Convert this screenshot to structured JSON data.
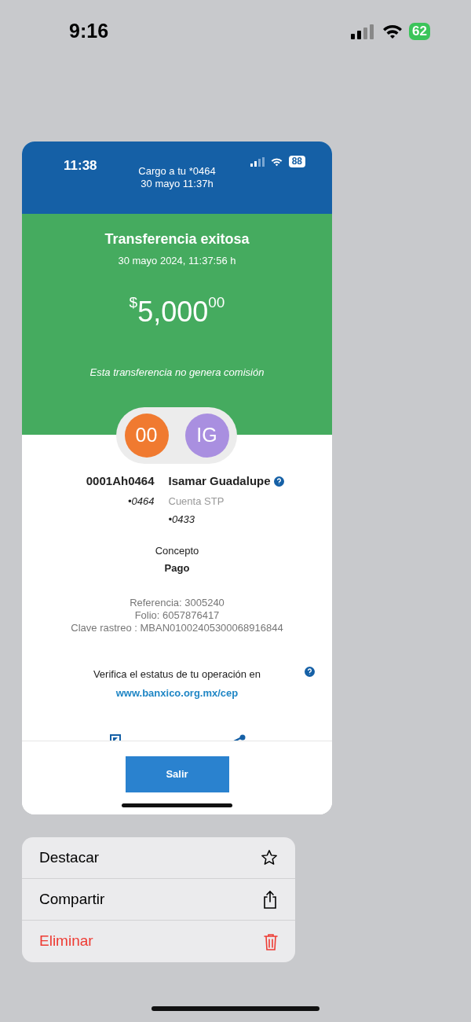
{
  "status_bar": {
    "time": "9:16",
    "battery": "62"
  },
  "preview": {
    "status_bar": {
      "time": "11:38",
      "battery": "88"
    },
    "notification": [
      "Cargo a tu *0464",
      "30 mayo 11:37h"
    ],
    "title": "Transferencia exitosa",
    "date": "30 mayo 2024, 11:37:56 h",
    "amount": {
      "currency": "$",
      "whole": "5,000",
      "cents": "00"
    },
    "note": "Esta transferencia no genera comisión",
    "parties": [
      {
        "initials": "00",
        "color": "#f07a30",
        "name": "0001Ah0464",
        "account": "•0464"
      },
      {
        "initials": "IG",
        "color": "#a98fe0",
        "name": "Isamar Guadalupe",
        "subtitle": "Cuenta STP",
        "account": "•0433"
      }
    ],
    "concept": {
      "label": "Concepto",
      "value": "Pago"
    },
    "references": [
      "Referencia: 3005240",
      "Folio: 6057876417",
      "Clave rastreo : MBAN01002405300068916844"
    ],
    "verify": {
      "text": "Verifica el estatus de tu operación en",
      "link": "www.banxico.org.mx/cep"
    },
    "button": "Salir"
  },
  "menu": [
    {
      "label": "Destacar",
      "kind": "normal"
    },
    {
      "label": "Compartir",
      "kind": "normal"
    },
    {
      "label": "Eliminar",
      "kind": "destructive"
    }
  ]
}
